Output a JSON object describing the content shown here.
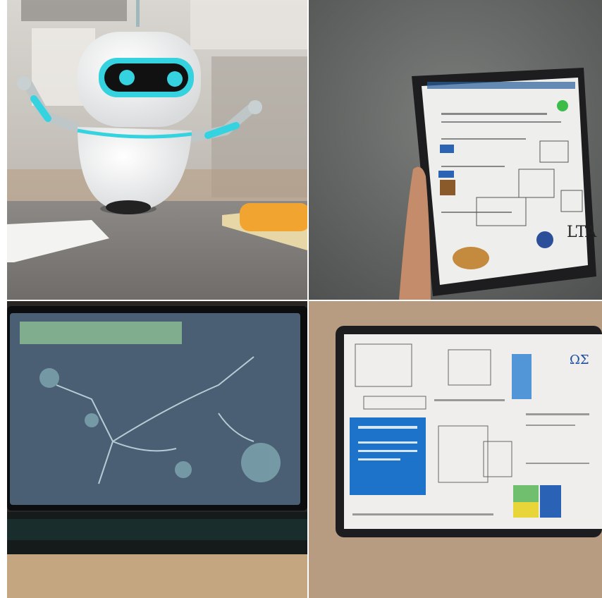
{
  "image": {
    "layout": "2x2 grid",
    "panels": [
      {
        "name": "robot-panel",
        "depicts": "robot-illustration"
      },
      {
        "name": "tablet-held-panel",
        "depicts": "hand-holding-tablet",
        "screen_text": "LTA"
      },
      {
        "name": "dark-tablet-panel",
        "depicts": "tablet-dark-map"
      },
      {
        "name": "tablet-document-panel",
        "depicts": "tablet-document-layout",
        "screen_text": "ΩΣ"
      }
    ]
  },
  "colors": {
    "robot_accent": "#35d2df",
    "robot_body": "#f2f2f0",
    "tablet_frame": "#1d1d1f",
    "blue_block": "#1c73c9",
    "green_bar": "#86c98f"
  }
}
